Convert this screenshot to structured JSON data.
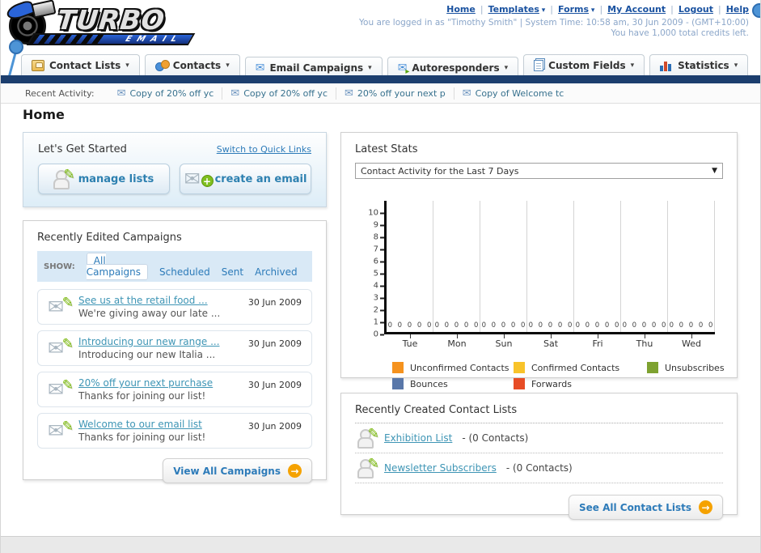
{
  "header": {
    "logo": {
      "primary": "TURBO",
      "secondary": "EMAIL"
    },
    "nav_links": [
      {
        "label": "Home",
        "dropdown": false
      },
      {
        "label": "Templates",
        "dropdown": true
      },
      {
        "label": "Forms",
        "dropdown": true
      },
      {
        "label": "My Account",
        "dropdown": false
      },
      {
        "label": "Logout",
        "dropdown": false
      },
      {
        "label": "Help",
        "dropdown": false
      }
    ],
    "login_info": "You are logged in as \"Timothy Smith\" | System Time: 10:58 am, 30 Jun 2009 - (GMT+10:00)",
    "credits_info": "You have 1,000 total credits left."
  },
  "nav_tabs": [
    {
      "label": "Contact Lists",
      "icon": "contact-lists"
    },
    {
      "label": "Contacts",
      "icon": "contacts"
    },
    {
      "label": "Email Campaigns",
      "icon": "email-campaigns"
    },
    {
      "label": "Autoresponders",
      "icon": "autoresponders"
    },
    {
      "label": "Custom Fields",
      "icon": "custom-fields"
    },
    {
      "label": "Statistics",
      "icon": "statistics"
    }
  ],
  "recent_activity": {
    "label": "Recent Activity:",
    "items": [
      "Copy of 20% off yc",
      "Copy of 20% off yc",
      "20% off your next p",
      "Copy of Welcome tc"
    ]
  },
  "page_title": "Home",
  "get_started": {
    "title": "Let's Get Started",
    "switch_link": "Switch to Quick Links",
    "manage_lists_label": "manage lists",
    "create_email_label": "create an email"
  },
  "campaigns": {
    "title": "Recently Edited Campaigns",
    "show_label": "SHOW:",
    "filters": [
      {
        "label": "All Campaigns",
        "active": true
      },
      {
        "label": "Scheduled",
        "active": false
      },
      {
        "label": "Sent",
        "active": false
      },
      {
        "label": "Archived",
        "active": false
      }
    ],
    "items": [
      {
        "title": "See us at the retail food ...",
        "subtitle": "We're giving away our late ...",
        "date": "30 Jun 2009"
      },
      {
        "title": "Introducing our new range ...",
        "subtitle": "Introducing our new Italia ...",
        "date": "30 Jun 2009"
      },
      {
        "title": "20% off your next purchase",
        "subtitle": "Thanks for joining our list!",
        "date": "30 Jun 2009"
      },
      {
        "title": "Welcome to our email list",
        "subtitle": "Thanks for joining our list!",
        "date": "30 Jun 2009"
      }
    ],
    "view_all_label": "View All Campaigns"
  },
  "stats": {
    "title": "Latest Stats",
    "dropdown_value": "Contact Activity for the Last 7 Days"
  },
  "chart_data": {
    "type": "bar",
    "title": "Contact Activity for the Last 7 Days",
    "categories": [
      "Tue",
      "Mon",
      "Sun",
      "Sat",
      "Fri",
      "Thu",
      "Wed"
    ],
    "series": [
      {
        "name": "Unconfirmed Contacts",
        "color": "#F5921E",
        "values": [
          0,
          0,
          0,
          0,
          0,
          0,
          0
        ]
      },
      {
        "name": "Confirmed Contacts",
        "color": "#F8C32A",
        "values": [
          0,
          0,
          0,
          0,
          0,
          0,
          0
        ]
      },
      {
        "name": "Unsubscribes",
        "color": "#7EA230",
        "values": [
          0,
          0,
          0,
          0,
          0,
          0,
          0
        ]
      },
      {
        "name": "Bounces",
        "color": "#5977A9",
        "values": [
          0,
          0,
          0,
          0,
          0,
          0,
          0
        ]
      },
      {
        "name": "Forwards",
        "color": "#E74C25",
        "values": [
          0,
          0,
          0,
          0,
          0,
          0,
          0
        ]
      }
    ],
    "ylim": [
      0,
      10
    ],
    "ytick_step": 1,
    "grid": true,
    "legend_position": "bottom",
    "xlabel": "",
    "ylabel": ""
  },
  "contact_lists": {
    "title": "Recently Created Contact Lists",
    "items": [
      {
        "name": "Exhibition List",
        "detail": "- (0 Contacts)"
      },
      {
        "name": "Newsletter Subscribers",
        "detail": "- (0 Contacts)"
      }
    ],
    "see_all_label": "See All Contact Lists"
  }
}
